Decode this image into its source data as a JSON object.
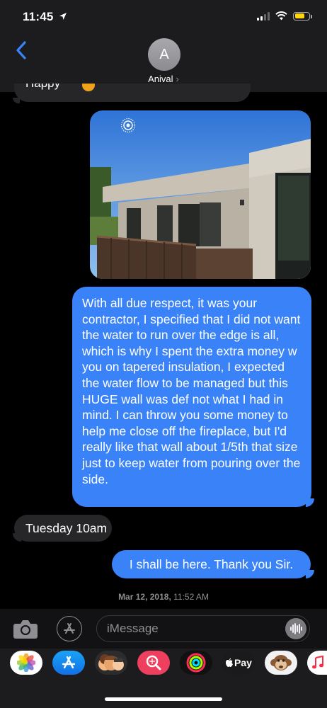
{
  "status_bar": {
    "time": "11:45",
    "location_arrow": "location-arrow-icon",
    "battery_color": "#ffd60a"
  },
  "header": {
    "contact_initial": "A",
    "contact_name": "Anival",
    "chevron": "›"
  },
  "messages": {
    "partial_incoming": "Happy",
    "long_outgoing": "With all due respect, it was your contractor, I specified that I did not want the water to run over the edge is all, which is why I spent the extra money w you on tapered insulation, I expected the water flow to be managed but this HUGE wall was def not what I had in mind.  I can throw you some money to help me close off the fireplace, but I'd really like that wall about  1/5th that size just to keep water from pouring over the side.",
    "incoming_reply": "Tuesday 10am",
    "outgoing_reply": "I shall be here. Thank you Sir."
  },
  "timestamp": {
    "date": "Mar 12, 2018,",
    "time": "11:52 AM"
  },
  "input": {
    "placeholder": "iMessage"
  },
  "colors": {
    "outgoing_bubble": "#3a82f7",
    "incoming_bubble": "#262629",
    "background": "#000000"
  },
  "app_drawer": {
    "apps": [
      {
        "name": "photos-icon"
      },
      {
        "name": "app-store-icon"
      },
      {
        "name": "memoji-icon"
      },
      {
        "name": "image-search-icon"
      },
      {
        "name": "activity-icon"
      },
      {
        "name": "apple-pay-icon",
        "label": "Pay"
      },
      {
        "name": "monkey-animoji-icon"
      },
      {
        "name": "music-icon"
      }
    ]
  }
}
